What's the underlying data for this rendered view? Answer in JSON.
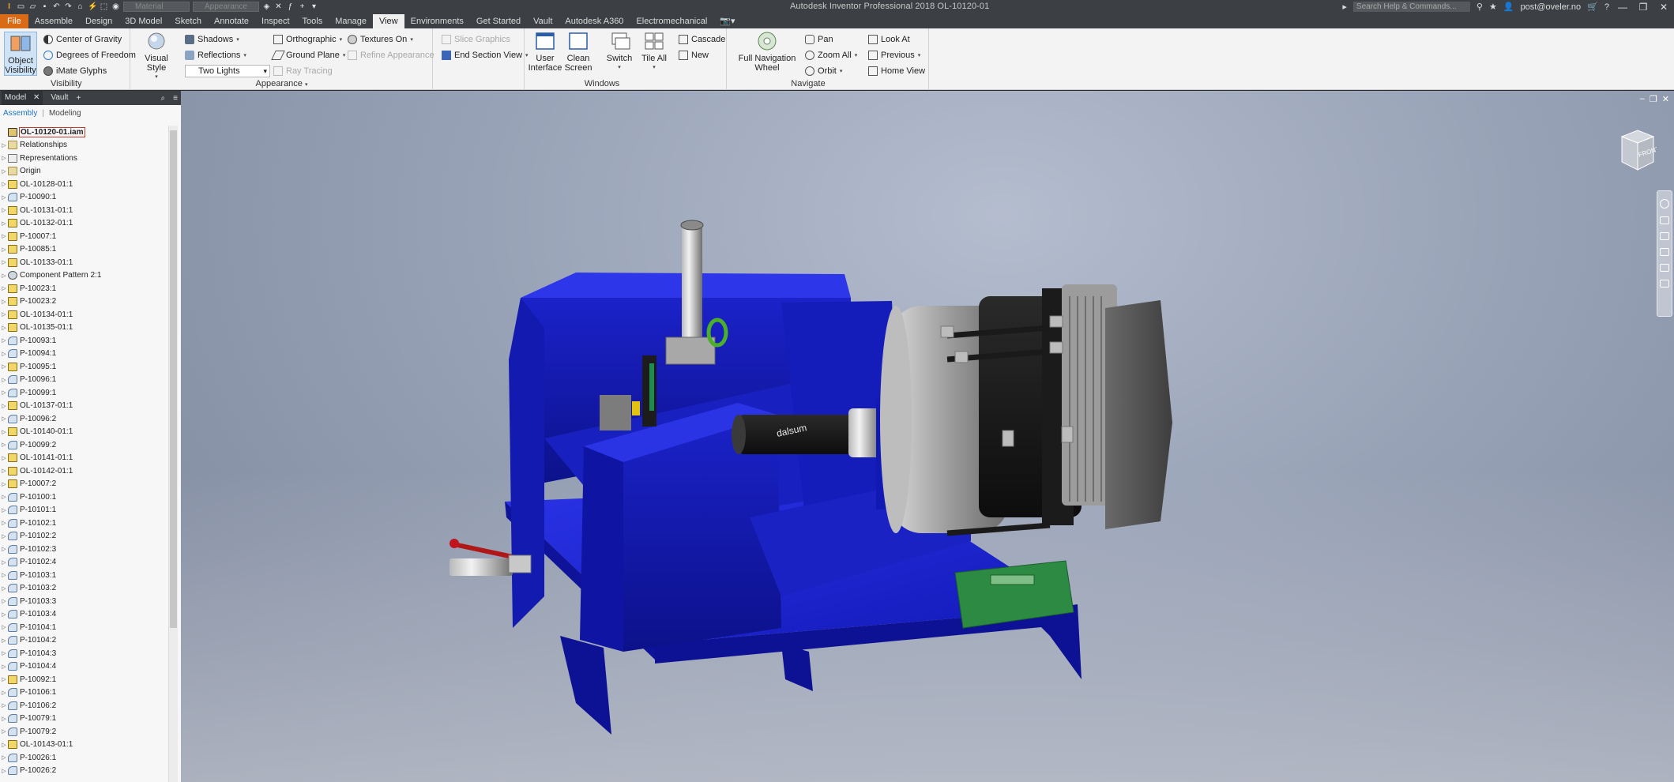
{
  "app": {
    "title": "Autodesk Inventor Professional 2018    OL-10120-01",
    "help_search_placeholder": "Search Help & Commands...",
    "user": "post@oveler.no",
    "material_combo": "Material",
    "appearance_combo": "Appearance"
  },
  "tabs": [
    "File",
    "Assemble",
    "Design",
    "3D Model",
    "Sketch",
    "Annotate",
    "Inspect",
    "Tools",
    "Manage",
    "View",
    "Environments",
    "Get Started",
    "Vault",
    "Autodesk A360",
    "Electromechanical"
  ],
  "active_tab": "View",
  "ribbon": {
    "visibility": {
      "title": "Visibility",
      "object_visibility": "Object\nVisibility",
      "center_of_gravity": "Center of Gravity",
      "degrees_of_freedom": "Degrees of Freedom",
      "imate_glyphs": "iMate Glyphs"
    },
    "appearance": {
      "title": "Appearance",
      "visual_style": "Visual Style",
      "shadows": "Shadows",
      "reflections": "Reflections",
      "lighting": "Two Lights",
      "orthographic": "Orthographic",
      "ground_plane": "Ground Plane",
      "ray_tracing": "Ray Tracing",
      "textures_on": "Textures On",
      "refine_appearance": "Refine Appearance",
      "slice_graphics": "Slice Graphics",
      "end_section_view": "End Section View"
    },
    "windows": {
      "title": "Windows",
      "user_interface": "User\nInterface",
      "clean_screen": "Clean\nScreen",
      "switch": "Switch",
      "tile_all": "Tile All",
      "cascade": "Cascade",
      "new": "New"
    },
    "navigate": {
      "title": "Navigate",
      "full_nav_wheel": "Full Navigation\nWheel",
      "pan": "Pan",
      "zoom_all": "Zoom All",
      "orbit": "Orbit",
      "look_at": "Look At",
      "previous": "Previous",
      "home_view": "Home View"
    }
  },
  "browser": {
    "tabs": [
      "Model",
      "Vault"
    ],
    "modes": [
      "Assembly",
      "Modeling"
    ],
    "nodes": [
      {
        "label": "OL-10120-01.iam",
        "icon": "root"
      },
      {
        "label": "Relationships",
        "icon": "folder"
      },
      {
        "label": "Representations",
        "icon": "rel"
      },
      {
        "label": "Origin",
        "icon": "folder"
      },
      {
        "label": "OL-10128-01:1",
        "icon": "asm"
      },
      {
        "label": "P-10090:1",
        "icon": "part"
      },
      {
        "label": "OL-10131-01:1",
        "icon": "asm"
      },
      {
        "label": "OL-10132-01:1",
        "icon": "asm"
      },
      {
        "label": "P-10007:1",
        "icon": "asm"
      },
      {
        "label": "P-10085:1",
        "icon": "asm"
      },
      {
        "label": "OL-10133-01:1",
        "icon": "asm"
      },
      {
        "label": "Component Pattern 2:1",
        "icon": "pattern"
      },
      {
        "label": "P-10023:1",
        "icon": "asm"
      },
      {
        "label": "P-10023:2",
        "icon": "asm"
      },
      {
        "label": "OL-10134-01:1",
        "icon": "asm"
      },
      {
        "label": "OL-10135-01:1",
        "icon": "asm"
      },
      {
        "label": "P-10093:1",
        "icon": "part"
      },
      {
        "label": "P-10094:1",
        "icon": "part"
      },
      {
        "label": "P-10095:1",
        "icon": "asm"
      },
      {
        "label": "P-10096:1",
        "icon": "part"
      },
      {
        "label": "P-10099:1",
        "icon": "part"
      },
      {
        "label": "OL-10137-01:1",
        "icon": "asm"
      },
      {
        "label": "P-10096:2",
        "icon": "part"
      },
      {
        "label": "OL-10140-01:1",
        "icon": "asm"
      },
      {
        "label": "P-10099:2",
        "icon": "part"
      },
      {
        "label": "OL-10141-01:1",
        "icon": "asm"
      },
      {
        "label": "OL-10142-01:1",
        "icon": "asm"
      },
      {
        "label": "P-10007:2",
        "icon": "asm"
      },
      {
        "label": "P-10100:1",
        "icon": "part"
      },
      {
        "label": "P-10101:1",
        "icon": "part"
      },
      {
        "label": "P-10102:1",
        "icon": "part"
      },
      {
        "label": "P-10102:2",
        "icon": "part"
      },
      {
        "label": "P-10102:3",
        "icon": "part"
      },
      {
        "label": "P-10102:4",
        "icon": "part"
      },
      {
        "label": "P-10103:1",
        "icon": "part"
      },
      {
        "label": "P-10103:2",
        "icon": "part"
      },
      {
        "label": "P-10103:3",
        "icon": "part"
      },
      {
        "label": "P-10103:4",
        "icon": "part"
      },
      {
        "label": "P-10104:1",
        "icon": "part"
      },
      {
        "label": "P-10104:2",
        "icon": "part"
      },
      {
        "label": "P-10104:3",
        "icon": "part"
      },
      {
        "label": "P-10104:4",
        "icon": "part"
      },
      {
        "label": "P-10092:1",
        "icon": "asm"
      },
      {
        "label": "P-10106:1",
        "icon": "part"
      },
      {
        "label": "P-10106:2",
        "icon": "part"
      },
      {
        "label": "P-10079:1",
        "icon": "part"
      },
      {
        "label": "P-10079:2",
        "icon": "part"
      },
      {
        "label": "OL-10143-01:1",
        "icon": "asm"
      },
      {
        "label": "P-10026:1",
        "icon": "part"
      },
      {
        "label": "P-10026:2",
        "icon": "part"
      }
    ]
  },
  "viewport": {
    "viewcube_label": "FRONT",
    "motor_brand": "dalsum"
  },
  "colors": {
    "accent_file": "#d96b16",
    "frame_blue": "#1b22c9",
    "ribbon_bg": "#f3f3f3",
    "dark_chrome": "#3c3f43"
  }
}
